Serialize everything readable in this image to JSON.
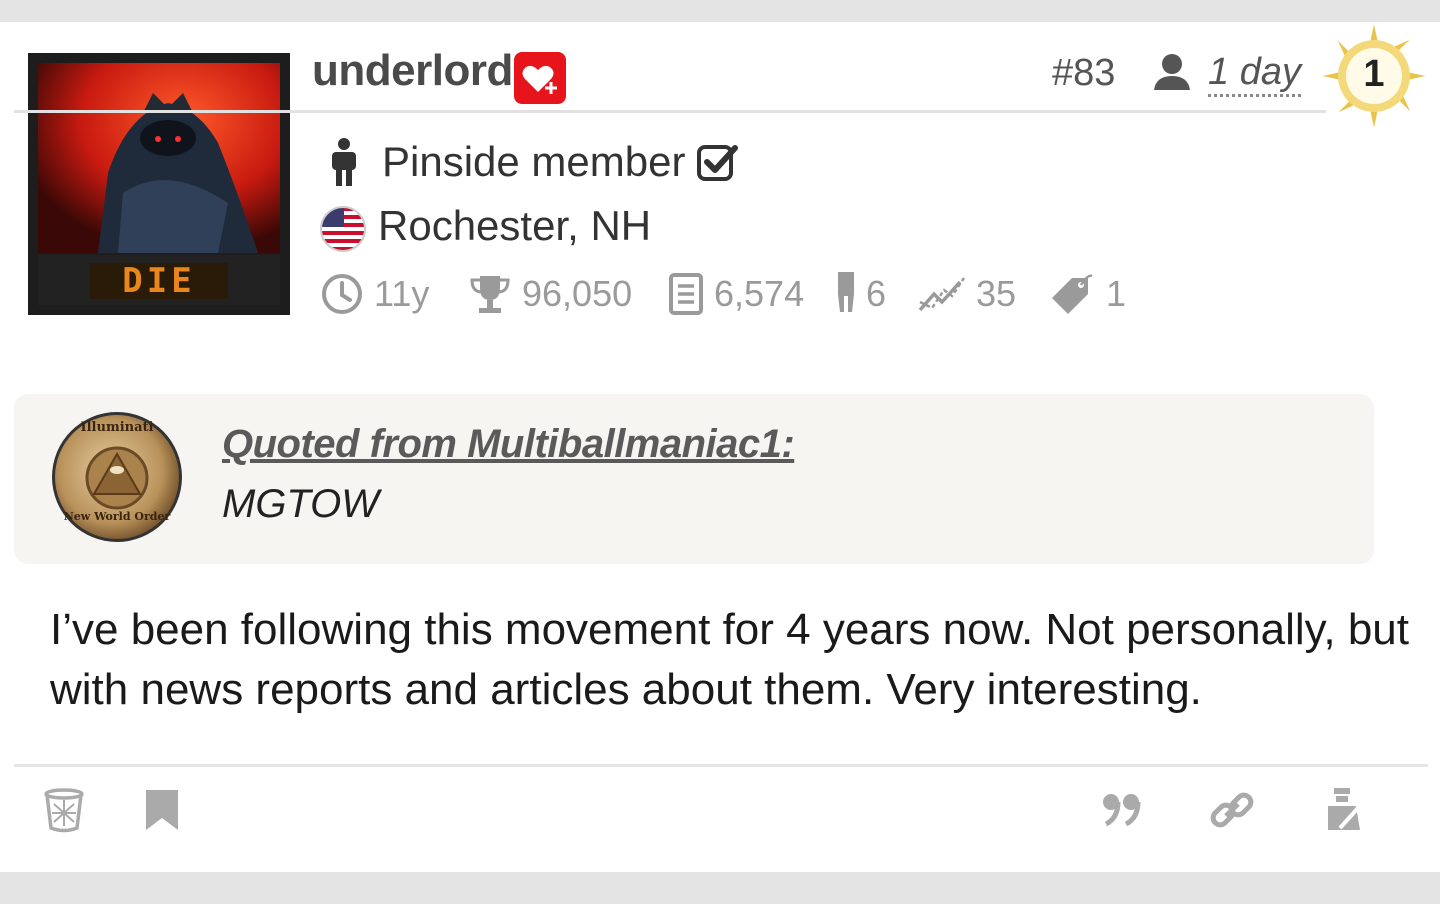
{
  "post": {
    "username": "underlord",
    "post_number": "#83",
    "age": "1 day",
    "badge_number": "1",
    "member_label": "Pinside member",
    "location": "Rochester, NH",
    "avatar_text": "DIE",
    "stats": {
      "membership": "11y",
      "score": "96,050",
      "posts": "6,574",
      "machines": "6",
      "trend": "35",
      "tags": "1"
    }
  },
  "quote": {
    "source": "Quoted from Multiballmaniac1:",
    "text": "MGTOW",
    "avatar_top_text": "Illuminati",
    "avatar_bottom_text": "New World Order"
  },
  "body": {
    "text": "I’ve been following this movement for 4 years now. Not personally, but with news reports and articles about them. Very interesting."
  },
  "icons": {
    "header": [
      "heart-plus-icon",
      "person-icon",
      "sun-badge-icon"
    ],
    "info": [
      "member-figure-icon",
      "check-square-icon",
      "us-flag-icon"
    ],
    "stats": [
      "clock-icon",
      "trophy-icon",
      "document-icon",
      "pinball-machine-icon",
      "trend-icon",
      "tag-icon"
    ],
    "footer": [
      "trash-icon",
      "bookmark-icon",
      "quote-icon",
      "link-icon",
      "report-icon"
    ]
  },
  "colors": {
    "accent_red": "#e8141c",
    "text_gray": "#9a9a9a",
    "quote_bg": "#f6f5f1"
  }
}
